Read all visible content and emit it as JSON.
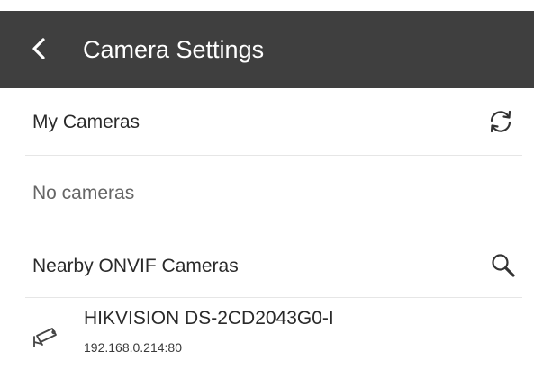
{
  "appbar": {
    "title": "Camera Settings",
    "back_icon": "chevron-left-icon",
    "background": "#3f3f3f"
  },
  "my_cameras": {
    "label": "My Cameras",
    "action_icon": "refresh-icon",
    "empty_text": "No cameras"
  },
  "nearby": {
    "label": "Nearby ONVIF Cameras",
    "action_icon": "search-icon",
    "cameras": [
      {
        "name": "HIKVISION DS-2CD2043G0-I",
        "address": "192.168.0.214:80",
        "icon": "security-camera-icon"
      }
    ]
  }
}
